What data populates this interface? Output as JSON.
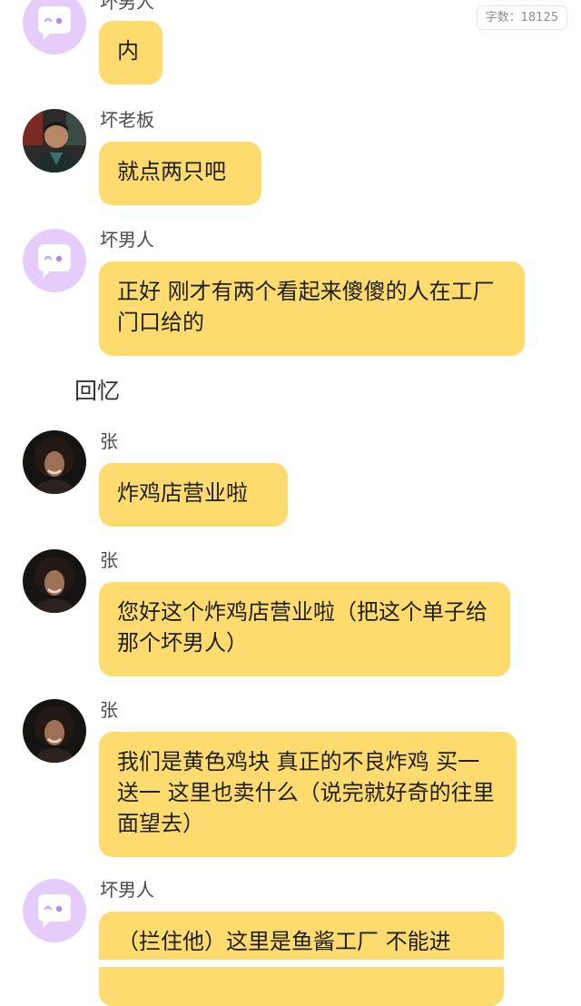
{
  "counter": {
    "text": "字数：18125"
  },
  "messages": [
    {
      "name": "坏男人",
      "text": "内",
      "avatar": "chat-bot-icon"
    },
    {
      "name": "坏老板",
      "text": "就点两只吧",
      "avatar": "boss-photo"
    },
    {
      "name": "坏男人",
      "text": "正好 刚才有两个看起来傻傻的人在工厂门口给的",
      "avatar": "chat-bot-icon"
    },
    {
      "name": "张",
      "text": "炸鸡店营业啦",
      "avatar": "zhang-photo"
    },
    {
      "name": "张",
      "text": "您好这个炸鸡店营业啦（把这个单子给那个坏男人）",
      "avatar": "zhang-photo"
    },
    {
      "name": "张",
      "text": "我们是黄色鸡块 真正的不良炸鸡 买一送一 这里也卖什么（说完就好奇的往里面望去）",
      "avatar": "zhang-photo"
    },
    {
      "name": "坏男人",
      "text": "（拦住他）这里是鱼酱工厂 不能进",
      "avatar": "chat-bot-icon"
    }
  ],
  "section": {
    "label": "回忆"
  },
  "colors": {
    "bubble": "#fddb6e",
    "bot_avatar": "#e5ccfb"
  }
}
